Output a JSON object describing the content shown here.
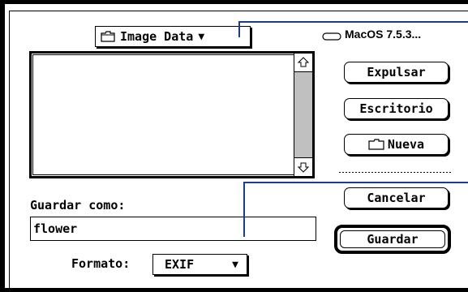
{
  "dialog": {
    "folder_popup": {
      "label": "Image Data",
      "icon": "folder-icon",
      "arrow_icon": "triangle-down-icon"
    },
    "disk": {
      "label": "MacOS 7.5.3...",
      "icon": "disk-icon"
    },
    "file_list": {
      "items": [],
      "scroll_up_icon": "scroll-up-arrow-icon",
      "scroll_down_icon": "scroll-down-arrow-icon"
    },
    "buttons": {
      "eject": "Expulsar",
      "desktop": "Escritorio",
      "new_folder": "Nueva",
      "new_folder_icon": "folder-icon",
      "cancel": "Cancelar",
      "save": "Guardar"
    },
    "save_as": {
      "label": "Guardar como:",
      "value": "flower"
    },
    "format": {
      "label": "Formato:",
      "value": "EXIF",
      "arrow_icon": "triangle-down-icon"
    }
  },
  "colors": {
    "callout": "#1a3d8f",
    "frame": "#000000",
    "scroll_track": "#c0c0c0"
  }
}
